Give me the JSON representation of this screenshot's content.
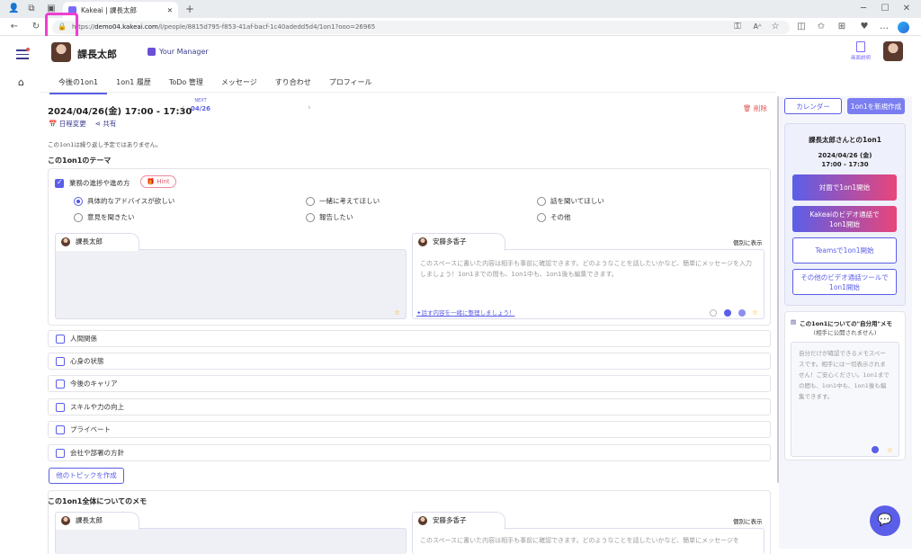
{
  "browser": {
    "tab_title": "Kakeai | 課長太郎",
    "url_scheme": "https://",
    "url_host": "demo04.kakeai.com",
    "url_path": "/l/people/8815d795-f853-41af-bacf-1c40adedd5d4/1on1?ooo=26965"
  },
  "header": {
    "user_name": "課長太郎",
    "manager_label": "Your Manager",
    "guide_label": "画面説明"
  },
  "tabs": [
    "今後の1on1",
    "1on1 履歴",
    "ToDo 管理",
    "メッセージ",
    "すり合わせ",
    "プロフィール"
  ],
  "session": {
    "datetime": "2024/04/26(金)  17:00 - 17:30",
    "next_label": "NEXT",
    "next_date": "04/26",
    "delete_label": "削除",
    "reschedule_label": "日程変更",
    "share_label": "共有",
    "no_repeat_notice": "この1on1は繰り返し予定ではありません。"
  },
  "theme": {
    "title": "この1on1のテーマ",
    "first_topic": "業務の進捗や進め方",
    "hint_label": "Hint",
    "radios": [
      {
        "label": "具体的なアドバイスが欲しい",
        "selected": true
      },
      {
        "label": "一緒に考えてほしい",
        "selected": false
      },
      {
        "label": "話を聞いてほしい",
        "selected": false
      },
      {
        "label": "意見を聞きたい",
        "selected": false
      },
      {
        "label": "報告したい",
        "selected": false
      },
      {
        "label": "その他",
        "selected": false
      }
    ],
    "memo_left_name": "課長太郎",
    "memo_right_name": "安藤多香子",
    "individual_label": "個別に表示",
    "memo_placeholder": "このスペースに書いた内容は相手も事前に確認できます。どのようなことを話したいかなど、簡単にメッセージを入力しましょう！1on1までの間も、1on1中も、1on1後も編集できます。",
    "memo_link": "話す内容を一緒に整理しましょう！",
    "other_topics": [
      "人間関係",
      "心身の状態",
      "今後のキャリア",
      "スキルや力の向上",
      "プライベート",
      "会社や部署の方針"
    ],
    "new_topic_button": "他のトピックを作成"
  },
  "overall_memo": {
    "title": "この1on1全体についてのメモ",
    "left_name": "課長太郎",
    "right_name": "安藤多香子",
    "individual_label": "個別に表示",
    "placeholder": "このスペースに書いた内容は相手も事前に確認できます。どのようなことを話したいかなど、簡単にメッセージを"
  },
  "right_panel": {
    "calendar_button": "カレンダー",
    "new_1on1_button": "1on1を新規作成",
    "card_title": "課長太郎さんとの1on1",
    "card_date": "2024/04/26 (金)",
    "card_time": "17:00 - 17:30",
    "face_to_face_button": "対面で1on1開始",
    "video_button": "Kakeaiのビデオ通話で1on1開始",
    "teams_button": "Teamsで1on1開始",
    "other_video_button": "その他のビデオ通話ツールで1on1開始",
    "private_memo_title": "この1on1についての\"自分用\"メモ",
    "private_memo_sub": "(相手に公開されません)",
    "private_memo_placeholder": "自分だけが確認できるメモスペースです。相手には一切表示されません！ご安心ください。1on1までの間も、1on1中も、1on1後も編集できます。"
  },
  "colors": {
    "accent": "#5b5ee8",
    "gradient_start": "#5b5ee8",
    "gradient_end": "#e8457a",
    "danger": "#e05555"
  }
}
